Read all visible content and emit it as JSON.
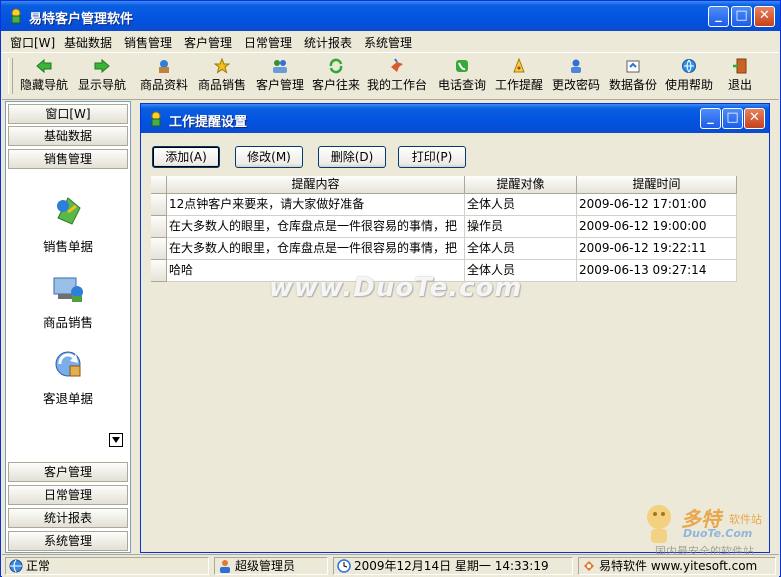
{
  "app": {
    "title": "易特客户管理软件"
  },
  "menu": [
    "窗口[W]",
    "基础数据",
    "销售管理",
    "客户管理",
    "日常管理",
    "统计报表",
    "系统管理"
  ],
  "toolbar": [
    "隐藏导航",
    "显示导航",
    "商品资料",
    "商品销售",
    "客户管理",
    "客户往来",
    "我的工作台",
    "电话查询",
    "工作提醒",
    "更改密码",
    "数据备份",
    "使用帮助",
    "退出"
  ],
  "sidebar": {
    "top_groups": [
      "窗口[W]",
      "基础数据",
      "销售管理"
    ],
    "items": [
      "销售单据",
      "商品销售",
      "客退单据"
    ],
    "bottom_groups": [
      "客户管理",
      "日常管理",
      "统计报表",
      "系统管理"
    ]
  },
  "dialog": {
    "title": "工作提醒设置",
    "buttons": {
      "add": "添加(A)",
      "edit": "修改(M)",
      "delete": "删除(D)",
      "print": "打印(P)"
    },
    "columns": [
      "提醒内容",
      "提醒对像",
      "提醒时间"
    ],
    "rows": [
      {
        "content": "12点钟客户来要来，请大家做好准备",
        "target": "全体人员",
        "time": "2009-06-12 17:01:00"
      },
      {
        "content": " 在大多数人的眼里，仓库盘点是一件很容易的事情，把",
        "target": "操作员",
        "time": "2009-06-12 19:00:00"
      },
      {
        "content": " 在大多数人的眼里，仓库盘点是一件很容易的事情，把",
        "target": "全体人员",
        "time": "2009-06-12 19:22:11"
      },
      {
        "content": "哈哈",
        "target": "全体人员",
        "time": "2009-06-13 09:27:14"
      }
    ]
  },
  "watermark": "www.DuoTe.com",
  "logo": {
    "name": "多特",
    "sub": "软件站",
    "site": "DuoTe.Com",
    "slogan": "国内最安全的软件站"
  },
  "status": {
    "state": "正常",
    "user": "超级管理员",
    "datetime": "2009年12月14日 星期一    14:33:19",
    "company": "易特软件 www.yitesoft.com"
  },
  "colors": {
    "titlebar": "#0254e0",
    "face": "#ece9d8",
    "border": "#0831d9"
  }
}
